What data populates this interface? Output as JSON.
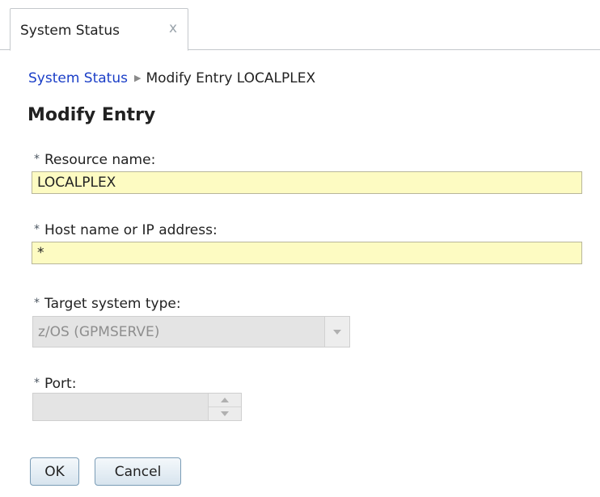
{
  "tabs": [
    {
      "label": "System Status",
      "close_glyph": "x",
      "close_icon": "close-icon"
    }
  ],
  "breadcrumb": {
    "link": "System Status",
    "separator_icon": "triangle-right-icon",
    "current": "Modify Entry LOCALPLEX"
  },
  "page_title": "Modify Entry",
  "form": {
    "required_marker": "*",
    "resource_name": {
      "label": "Resource name:",
      "value": "LOCALPLEX"
    },
    "host": {
      "label": "Host name or IP address:",
      "value": "*"
    },
    "target_system_type": {
      "label": "Target system type:",
      "selected": "z/OS (GPMSERVE)",
      "disabled": true
    },
    "port": {
      "label": "Port:",
      "value": "",
      "disabled": true
    }
  },
  "buttons": {
    "ok": "OK",
    "cancel": "Cancel"
  },
  "colors": {
    "link": "#1a3ec7",
    "required_input_bg": "#fdfbc2",
    "disabled_bg": "#e4e4e4",
    "button_border": "#7a9cb6"
  }
}
